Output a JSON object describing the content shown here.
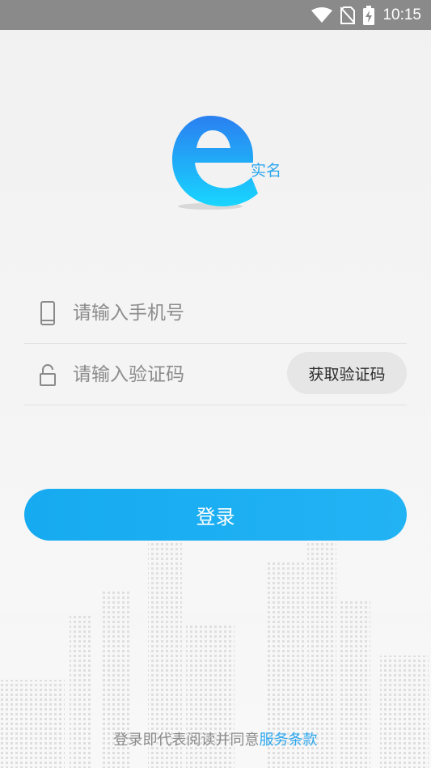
{
  "status_bar": {
    "time": "10:15",
    "icons": [
      "wifi-icon",
      "no-sim-icon",
      "battery-charging-icon"
    ]
  },
  "logo": {
    "text": "实名",
    "colors": {
      "gradient_start": "#2a7ff0",
      "gradient_end": "#18d6ff"
    }
  },
  "phone_field": {
    "placeholder": "请输入手机号",
    "value": "",
    "icon": "phone-icon"
  },
  "code_field": {
    "placeholder": "请输入验证码",
    "value": "",
    "icon": "lock-icon",
    "button_label": "获取验证码"
  },
  "login_button": {
    "label": "登录",
    "color": "#1aaef2"
  },
  "agreement": {
    "prefix": "登录即代表阅读并同意",
    "link": "服务条款",
    "link_color": "#2aa6ee"
  }
}
